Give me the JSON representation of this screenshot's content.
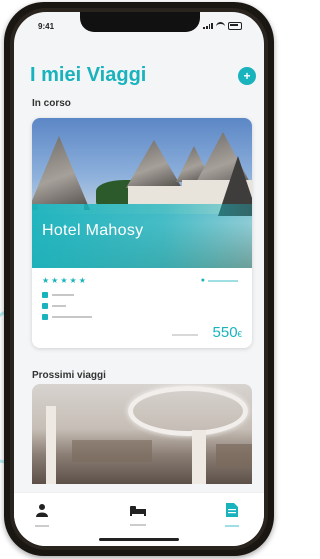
{
  "status": {
    "time": "9:41"
  },
  "header": {
    "title": "I miei Viaggi",
    "add_icon": "plus-circle-icon"
  },
  "sections": {
    "current": "In corso",
    "upcoming": "Prossimi viaggi"
  },
  "current_trip": {
    "name": "Hotel Mahosy",
    "rating": 5,
    "price": "550",
    "price_currency": "€"
  },
  "colors": {
    "accent": "#19b3bd"
  },
  "tabs": [
    {
      "icon": "person-icon"
    },
    {
      "icon": "bed-icon"
    },
    {
      "icon": "document-icon"
    }
  ]
}
